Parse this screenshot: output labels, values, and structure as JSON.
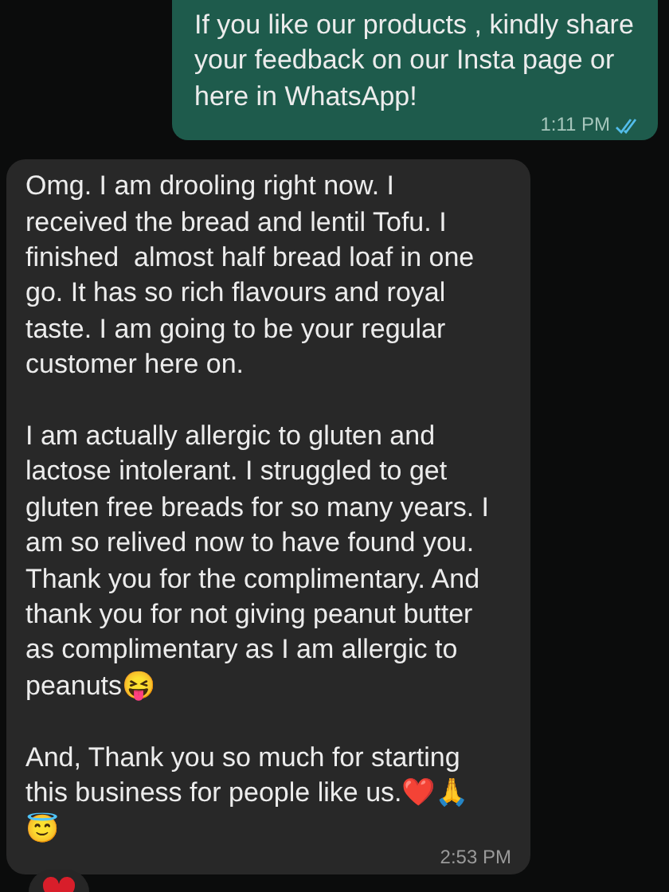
{
  "messages": [
    {
      "kind": "outgoing",
      "paragraphs": [
        "If you like our products , kindly share your feedback on our Insta page or here in WhatsApp!"
      ],
      "time": "1:11 PM",
      "read": true
    },
    {
      "kind": "incoming",
      "paragraphs": [
        "Omg. I am drooling right now. I received the bread and lentil Tofu. I finished  almost half bread loaf in one go. It has so rich flavours and royal taste. I am going to be your regular customer here on.",
        "I am actually allergic to gluten and lactose intolerant. I struggled to get gluten free breads for so many years. I am so relived now to have found you. Thank you for the complimentary. And thank you for not giving peanut butter as complimentary as I am allergic to peanuts😝",
        "And, Thank you so much for starting this business for people like us.❤️🙏😇"
      ],
      "time": "2:53 PM",
      "reacted": true
    }
  ]
}
